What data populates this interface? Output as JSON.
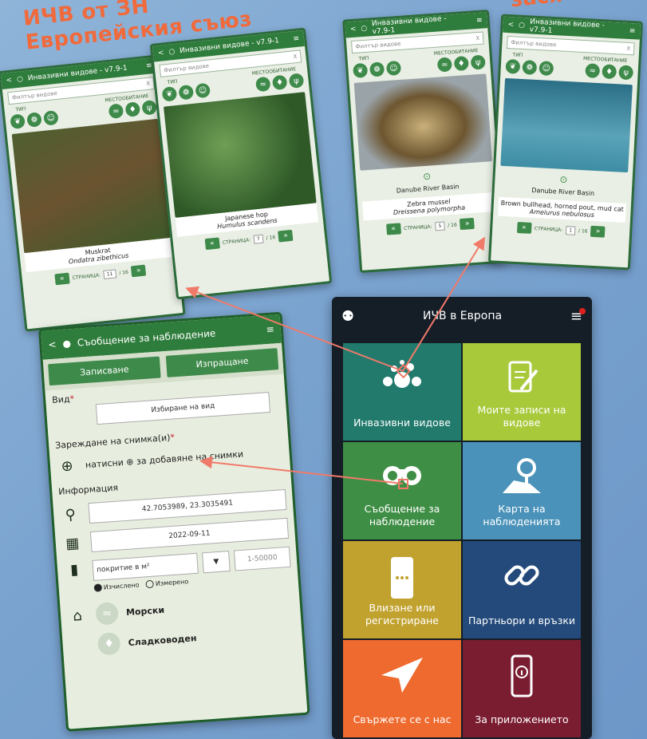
{
  "headline": {
    "line1": "ИЧВ от ЗН",
    "line2": "Европейския съюз",
    "right": "зася"
  },
  "species_screens": [
    {
      "app_title": "Инвазивни видове - v7.9-1",
      "filter_placeholder": "Филтър видове",
      "filter_clear": "X",
      "type_label": "ТИП",
      "habitat_label": "МЕСТООБИТАНИЕ",
      "basin": "",
      "common_name": "Muskrat",
      "latin_name": "Ondatra zibethicus",
      "page_label": "СТРАНИЦА:",
      "page": "11",
      "page_total": "/ 16"
    },
    {
      "app_title": "Инвазивни видове - v7.9-1",
      "filter_placeholder": "Филтър видове",
      "filter_clear": "X",
      "type_label": "ТИП",
      "habitat_label": "МЕСТООБИТАНИЕ",
      "basin": "",
      "common_name": "Japanese hop",
      "latin_name": "Humulus scandens",
      "page_label": "СТРАНИЦА:",
      "page": "7",
      "page_total": "/ 16"
    },
    {
      "app_title": "Инвазивни видове - v7.9-1",
      "filter_placeholder": "Филтър видове",
      "filter_clear": "X",
      "type_label": "ТИП",
      "habitat_label": "МЕСТООБИТАНИЕ",
      "basin": "Danube River Basin",
      "common_name": "Zebra mussel",
      "latin_name": "Dreissena polymorpha",
      "page_label": "СТРАНИЦА:",
      "page": "5",
      "page_total": "/ 16"
    },
    {
      "app_title": "Инвазивни видове - v7.9-1",
      "filter_placeholder": "Филтър видове",
      "filter_clear": "X",
      "type_label": "ТИП",
      "habitat_label": "МЕСТООБИТАНИЕ",
      "basin": "Danube River Basin",
      "common_name": "Brown bullhead, horned pout, mud cat",
      "latin_name": "Ameiurus nebulosus",
      "page_label": "СТРАНИЦА:",
      "page": "1",
      "page_total": "/ 16"
    }
  ],
  "form": {
    "title": "Съобщение за наблюдение",
    "save_label": "Записване",
    "send_label": "Изпращане",
    "species_label": "Вид",
    "species_button": "Избиране на вид",
    "photo_label": "Зареждане на снимка(и)",
    "photo_hint": "натисни ⊕ за добавяне на снимки",
    "info_label": "Информация",
    "coordinates": "42.7053989, 23.3035491",
    "date": "2022-09-11",
    "coverage_label": "покритие в м²",
    "coverage_range": "1-50000",
    "radio_calculated": "Изчислено",
    "radio_measured": "Измерено",
    "habitat_marine": "Морски",
    "habitat_fresh": "Сладководен"
  },
  "main_menu": {
    "title": "ИЧВ в Европа",
    "tiles": [
      {
        "label": "Инвазивни видове",
        "icon": "dots-cluster-icon",
        "color": "#227a6c"
      },
      {
        "label": "Моите записи на видове",
        "icon": "clipboard-edit-icon",
        "color": "#a8c93a"
      },
      {
        "label": "Съобщение за наблюдение",
        "icon": "binoculars-icon",
        "color": "#3f8e45"
      },
      {
        "label": "Карта на наблюденията",
        "icon": "map-pin-icon",
        "color": "#4a92b9"
      },
      {
        "label": "Влизане или регистриране",
        "icon": "smartphone-icon",
        "color": "#c1a22f"
      },
      {
        "label": "Партньори и връзки",
        "icon": "link-icon",
        "color": "#234a7a"
      },
      {
        "label": "Свържете се с нас",
        "icon": "paper-plane-icon",
        "color": "#ef6a2e"
      },
      {
        "label": "За приложението",
        "icon": "phone-info-icon",
        "color": "#7a1d30"
      }
    ]
  },
  "colors": {
    "accent_orange": "#f06a3c",
    "app_green": "#2f7d3c",
    "arrow": "#f07a6a"
  }
}
